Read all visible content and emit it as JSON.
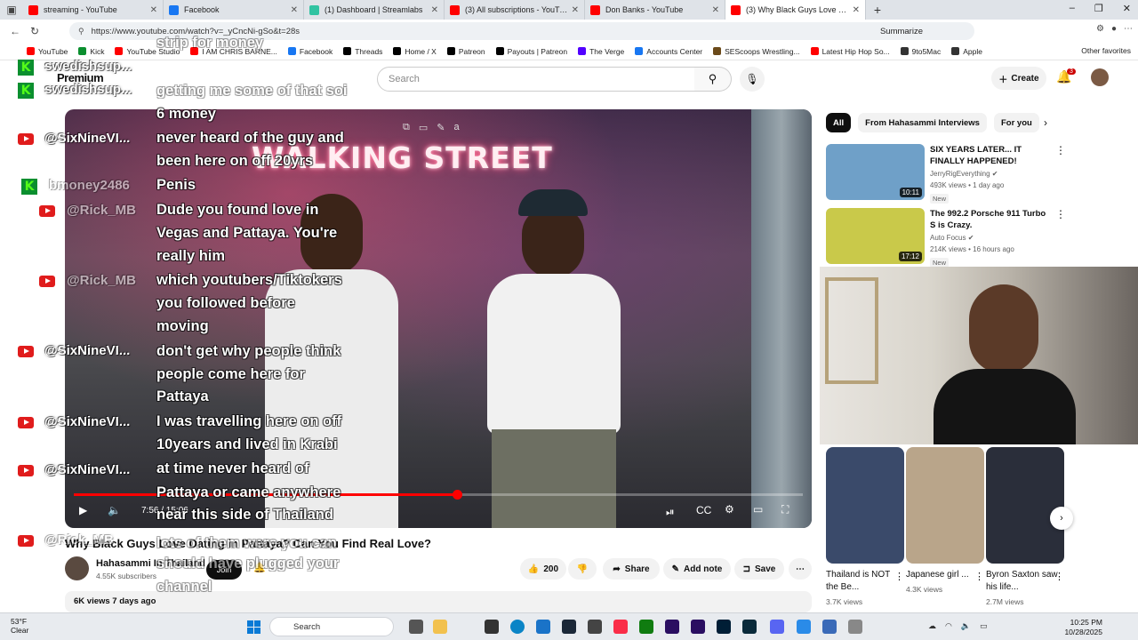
{
  "browser": {
    "tabs": [
      {
        "title": "streaming - YouTube",
        "color": "#ff0000"
      },
      {
        "title": "Facebook",
        "color": "#1877f2"
      },
      {
        "title": "(1) Dashboard | Streamlabs",
        "color": "#31c3a2"
      },
      {
        "title": "(3) All subscriptions - YouTube",
        "color": "#ff0000"
      },
      {
        "title": "Don Banks - YouTube",
        "color": "#ff0000"
      },
      {
        "title": "(3) Why Black Guys Love Dating",
        "color": "#ff0000",
        "active": true
      }
    ],
    "url": "https://www.youtube.com/watch?v=_yCncNi-gSo&t=28s",
    "summarize_label": "Summarize",
    "bookmarks": [
      {
        "label": "YouTube",
        "color": "#ff0000"
      },
      {
        "label": "Kick",
        "color": "#0b8f2f"
      },
      {
        "label": "YouTube Studio",
        "color": "#ff0000"
      },
      {
        "label": "I AM CHRIS BARNE...",
        "color": "#ff0000"
      },
      {
        "label": "Facebook",
        "color": "#1877f2"
      },
      {
        "label": "Threads",
        "color": "#000000"
      },
      {
        "label": "Home / X",
        "color": "#000000"
      },
      {
        "label": "Patreon",
        "color": "#000000"
      },
      {
        "label": "Payouts | Patreon",
        "color": "#000000"
      },
      {
        "label": "The Verge",
        "color": "#5200ff"
      },
      {
        "label": "Accounts Center",
        "color": "#1877f2"
      },
      {
        "label": "SEScoops Wrestling...",
        "color": "#6b4a1a"
      },
      {
        "label": "Latest Hip Hop So...",
        "color": "#ff0000"
      },
      {
        "label": "9to5Mac",
        "color": "#333333"
      },
      {
        "label": "Apple",
        "color": "#333333"
      }
    ],
    "other_favorites": "Other favorites"
  },
  "yt_header": {
    "logo": "Premium",
    "search_placeholder": "Search",
    "create_label": "Create",
    "notif_count": "3"
  },
  "player": {
    "sign_text": "WALKING STREET",
    "time": "7:56 / 15:06",
    "progress": 0.525
  },
  "video": {
    "title": "Why Black Guys Love Dating in Pattaya? Can You Find Real Love?",
    "channel": "Hahasammi In Thailand",
    "subscribers": "4.55K subscribers",
    "join": "Join",
    "likes": "200",
    "share": "Share",
    "add_note": "Add note",
    "save": "Save",
    "desc_meta": "6K views  7 days ago"
  },
  "chips": [
    "All",
    "From Hahasammi Interviews",
    "For you"
  ],
  "recommendations": [
    {
      "title": "SIX YEARS LATER... IT FINALLY HAPPENED!",
      "channel": "JerryRigEverything",
      "meta": "493K views • 1 day ago",
      "duration": "10:11",
      "badge": "New",
      "thumb": "#6fa0c8"
    },
    {
      "title": "The 992.2 Porsche 911 Turbo S is Crazy.",
      "channel": "Auto Focus",
      "meta": "214K views • 16 hours ago",
      "duration": "17:12",
      "badge": "New",
      "thumb": "#c9c94a"
    }
  ],
  "shorts": [
    {
      "title": "Thailand is NOT the Be...",
      "views": "3.7K views",
      "thumb": "#3a4a6a"
    },
    {
      "title": "Japanese girl ...",
      "views": "4.3K views",
      "thumb": "#b9a58a"
    },
    {
      "title": "Byron Saxton saw his life...",
      "views": "2.7M views",
      "thumb": "#2a2e3a"
    }
  ],
  "overlay": {
    "users": [
      {
        "name": "swedishsup...",
        "platform": "kick",
        "row": 0
      },
      {
        "name": "swedishsup...",
        "platform": "kick",
        "row": 1
      },
      {
        "name": "@SixNineVI...",
        "platform": "youtube",
        "row": 2
      },
      {
        "name": "bmoney2486",
        "platform": "kick",
        "row": 3
      },
      {
        "name": "@Rick_MB",
        "platform": "youtube",
        "row": 4
      },
      {
        "name": "@Rick_MB",
        "platform": "youtube",
        "row": 5
      },
      {
        "name": "@SixNineVI...",
        "platform": "youtube",
        "row": 6
      },
      {
        "name": "@SixNineVI...",
        "platform": "youtube",
        "row": 7
      },
      {
        "name": "@SixNineVI...",
        "platform": "youtube",
        "row": 8
      },
      {
        "name": "@Rick_MB",
        "platform": "youtube",
        "row": 9
      }
    ],
    "messages": [
      "strip for money",
      "getting me some of that soi",
      "6 money",
      "never heard of the guy and",
      "been here on off 20yrs",
      "Penis",
      "Dude you found love in",
      "Vegas and Pattaya. You're",
      "really him",
      "which youtubers/Tiktokers",
      "you followed before",
      "moving",
      "don't get why people think",
      "people come here for",
      "Pattaya",
      "I was travelling here on off",
      "10years and lived in Krabi",
      "at time never heard of",
      "Pattaya or came anywhere",
      "near this side of Thailand",
      "lots of them were you can",
      "should have plugged your",
      "channel"
    ]
  },
  "taskbar": {
    "temp": "53°F",
    "condition": "Clear",
    "search": "Search",
    "time": "10:25 PM",
    "date": "10/28/2025"
  }
}
